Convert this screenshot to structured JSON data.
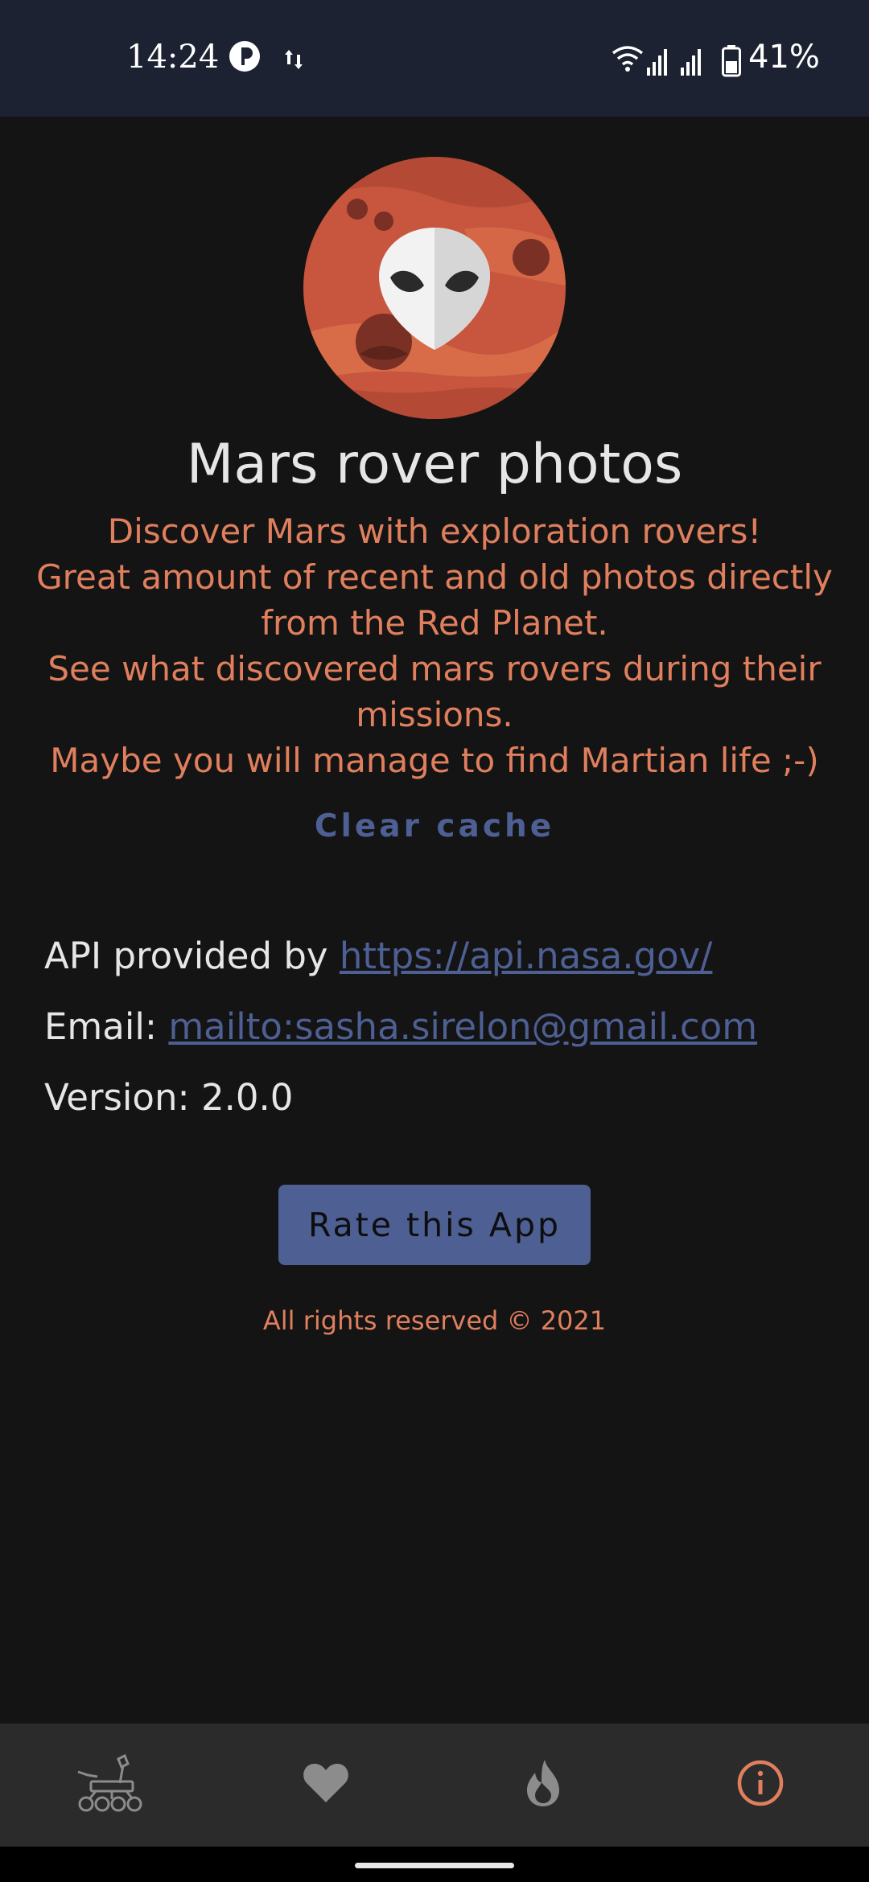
{
  "status_bar": {
    "time": "14:24",
    "battery": "41%",
    "icons": [
      "app-notification-icon",
      "data-transfer-icon",
      "wifi-icon",
      "signal-icon",
      "signal-icon",
      "battery-icon"
    ]
  },
  "app": {
    "title": "Mars rover photos",
    "description_lines": [
      "Discover Mars with exploration rovers!",
      "Great amount of recent and old photos directly",
      "from the Red Planet.",
      "See what discovered mars rovers during their",
      "missions.",
      "Maybe you will manage to find Martian life ;-)"
    ],
    "clear_cache_label": "Clear cache"
  },
  "info": {
    "api_prefix": "API provided by ",
    "api_link": "https://api.nasa.gov/",
    "email_prefix": "Email: ",
    "email_link": "mailto:sasha.sirelon@gmail.com",
    "version": "Version: 2.0.0"
  },
  "rate_button_label": "Rate this App",
  "copyright": "All rights reserved © 2021",
  "bottom_nav": {
    "items": [
      {
        "icon": "rover-icon",
        "active": false
      },
      {
        "icon": "heart-icon",
        "active": false
      },
      {
        "icon": "fire-icon",
        "active": false
      },
      {
        "icon": "info-icon",
        "active": true
      }
    ]
  },
  "colors": {
    "accent": "#e07f5d",
    "link": "#4d5f93",
    "background": "#141414",
    "status_bar": "#1c2232",
    "nav_bar": "#2b2b2b"
  }
}
